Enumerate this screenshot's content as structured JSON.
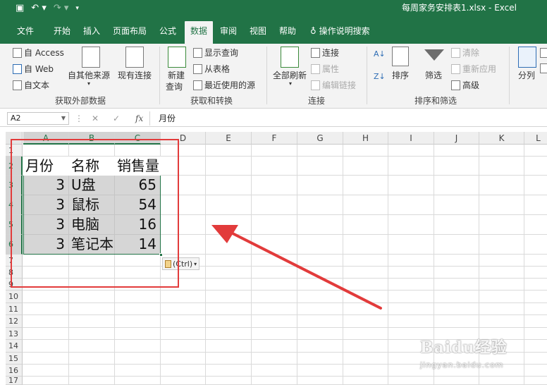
{
  "titlebar": {
    "doc_title": "每周家务安排表1.xlsx  -  Excel",
    "save_icon": "save-icon",
    "undo_icon": "undo-icon",
    "redo_icon": "redo-icon",
    "customize_icon": "customize-qat-icon",
    "background": "#217346"
  },
  "tabs": {
    "items": [
      "文件",
      "开始",
      "插入",
      "页面布局",
      "公式",
      "数据",
      "审阅",
      "视图",
      "帮助"
    ],
    "active": "数据",
    "tell_me": "操作说明搜索"
  },
  "ribbon": {
    "external": {
      "access": "自 Access",
      "web": "自 Web",
      "text": "自文本",
      "other": "自其他来源",
      "existing": "现有连接",
      "label": "获取外部数据"
    },
    "transform": {
      "new_query": "新建",
      "new_query_2": "查询",
      "show_queries": "显示查询",
      "from_table": "从表格",
      "recent": "最近使用的源",
      "label": "获取和转换"
    },
    "connections": {
      "refresh_all": "全部刷新",
      "connections": "连接",
      "properties": "属性",
      "edit_links": "编辑链接",
      "label": "连接"
    },
    "sort_filter": {
      "sort": "排序",
      "filter": "筛选",
      "clear": "清除",
      "reapply": "重新应用",
      "advanced": "高级",
      "label": "排序和筛选"
    },
    "data_tools": {
      "split": "分列"
    }
  },
  "formula_bar": {
    "name_box": "A2",
    "fx": "fx",
    "content": "月份",
    "cancel": "✕",
    "enter": "✓"
  },
  "grid": {
    "columns": [
      "A",
      "B",
      "C",
      "D",
      "E",
      "F",
      "G",
      "H",
      "I",
      "J",
      "K",
      "L"
    ],
    "rows": [
      "1",
      "2",
      "3",
      "4",
      "5",
      "6",
      "7",
      "8",
      "9",
      "10",
      "11",
      "12",
      "13",
      "14",
      "15",
      "16",
      "17"
    ],
    "header_row": [
      "月份",
      "名称",
      "销售量"
    ],
    "data_rows": [
      [
        "3",
        "U盘",
        "65"
      ],
      [
        "3",
        "鼠标",
        "54"
      ],
      [
        "3",
        "电脑",
        "16"
      ],
      [
        "3",
        "笔记本",
        "14"
      ]
    ]
  },
  "paste_options": {
    "label": "(Ctrl)",
    "caret": "▾",
    "icon": "paste-clipboard-icon"
  },
  "annotation": {
    "color": "#e23b3b"
  },
  "watermark": {
    "brand": "Baidu经验",
    "url": "jingyan.baidu.com"
  }
}
